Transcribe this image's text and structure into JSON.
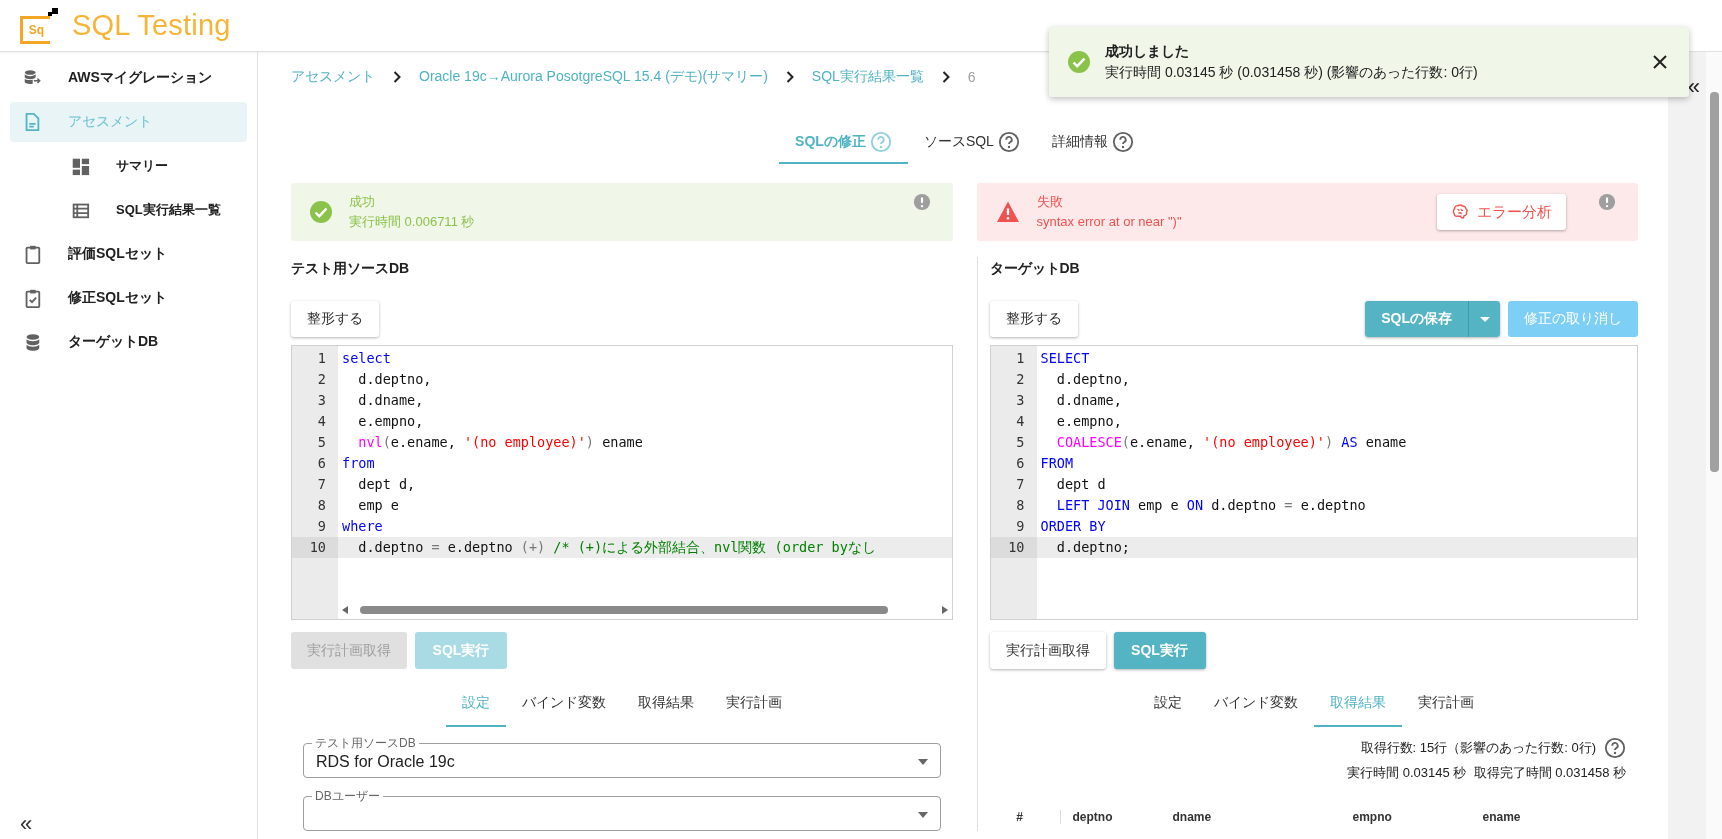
{
  "app": {
    "title": "SQL Testing",
    "logo_text": "Sq"
  },
  "sidebar": {
    "items": [
      {
        "label": "AWSマイグレーション",
        "selected": false
      },
      {
        "label": "アセスメント",
        "selected": true,
        "children": [
          {
            "label": "サマリー",
            "selected": false
          },
          {
            "label": "SQL実行結果一覧",
            "selected": false
          }
        ]
      },
      {
        "label": "評価SQLセット",
        "selected": false
      },
      {
        "label": "修正SQLセット",
        "selected": false
      },
      {
        "label": "ターゲットDB",
        "selected": false
      }
    ],
    "collapse_label": "«"
  },
  "breadcrumb": [
    {
      "label": "アセスメント",
      "link": true
    },
    {
      "label": "Oracle 19c→Aurora PosotgreSQL 15.4 (デモ)(サマリー)",
      "link": true
    },
    {
      "label": "SQL実行結果一覧",
      "link": true
    },
    {
      "label": "6",
      "link": false
    }
  ],
  "tabs": [
    {
      "label": "SQLの修正",
      "selected": true
    },
    {
      "label": "ソースSQL",
      "selected": false
    },
    {
      "label": "詳細情報",
      "selected": false
    }
  ],
  "source_panel": {
    "status": {
      "kind": "success",
      "title": "成功",
      "message": "実行時間 0.006711 秒"
    },
    "heading": "テスト用ソースDB",
    "format_button": "整形する",
    "code": [
      {
        "number": "1",
        "active": false,
        "tokens": [
          {
            "kind": "kw",
            "text": "select"
          }
        ]
      },
      {
        "number": "2",
        "active": false,
        "tokens": [
          {
            "kind": "plain",
            "text": "  d.deptno,"
          }
        ]
      },
      {
        "number": "3",
        "active": false,
        "tokens": [
          {
            "kind": "plain",
            "text": "  d.dname,"
          }
        ]
      },
      {
        "number": "4",
        "active": false,
        "tokens": [
          {
            "kind": "plain",
            "text": "  e.empno,"
          }
        ]
      },
      {
        "number": "5",
        "active": false,
        "tokens": [
          {
            "kind": "fn",
            "text": "  nvl"
          },
          {
            "kind": "punct",
            "text": "("
          },
          {
            "kind": "plain",
            "text": "e.ename, "
          },
          {
            "kind": "str",
            "text": "'(no employee)'"
          },
          {
            "kind": "punct",
            "text": ")"
          },
          {
            "kind": "plain",
            "text": " ename"
          }
        ]
      },
      {
        "number": "6",
        "active": false,
        "tokens": [
          {
            "kind": "kw",
            "text": "from"
          }
        ]
      },
      {
        "number": "7",
        "active": false,
        "tokens": [
          {
            "kind": "plain",
            "text": "  dept d,"
          }
        ]
      },
      {
        "number": "8",
        "active": false,
        "tokens": [
          {
            "kind": "plain",
            "text": "  emp e"
          }
        ]
      },
      {
        "number": "9",
        "active": false,
        "tokens": [
          {
            "kind": "kw",
            "text": "where"
          }
        ]
      },
      {
        "number": "10",
        "active": true,
        "tokens": [
          {
            "kind": "plain",
            "text": "  d.deptno "
          },
          {
            "kind": "punct",
            "text": "="
          },
          {
            "kind": "plain",
            "text": " e.deptno "
          },
          {
            "kind": "punct",
            "text": "(+) "
          },
          {
            "kind": "cmt",
            "text": "/* (+)による外部結合、nvl関数 (order byなし"
          }
        ]
      }
    ],
    "actions": [
      {
        "label": "実行計画取得",
        "kind": "outline",
        "disabled": true
      },
      {
        "label": "SQL実行",
        "kind": "primary",
        "disabled": true
      }
    ],
    "subtabs": [
      {
        "label": "設定",
        "selected": true
      },
      {
        "label": "バインド変数",
        "selected": false
      },
      {
        "label": "取得結果",
        "selected": false
      },
      {
        "label": "実行計画",
        "selected": false
      }
    ],
    "fields": [
      {
        "label": "テスト用ソースDB",
        "value": "RDS for Oracle 19c"
      },
      {
        "label": "DBユーザー"
      }
    ]
  },
  "target_panel": {
    "status": {
      "kind": "error",
      "title": "失敗",
      "message": "syntax error at or near \")\"",
      "action": "エラー分析"
    },
    "heading": "ターゲットDB",
    "format_button": "整形する",
    "save_button": "SQLの保存",
    "undo_button": {
      "label": "修正の取り消し",
      "disabled": true
    },
    "code": [
      {
        "number": "1",
        "active": false,
        "tokens": [
          {
            "kind": "kw",
            "text": "SELECT"
          }
        ]
      },
      {
        "number": "2",
        "active": false,
        "tokens": [
          {
            "kind": "plain",
            "text": "  d.deptno,"
          }
        ]
      },
      {
        "number": "3",
        "active": false,
        "tokens": [
          {
            "kind": "plain",
            "text": "  d.dname,"
          }
        ]
      },
      {
        "number": "4",
        "active": false,
        "tokens": [
          {
            "kind": "plain",
            "text": "  e.empno,"
          }
        ]
      },
      {
        "number": "5",
        "active": false,
        "tokens": [
          {
            "kind": "fn",
            "text": "  COALESCE"
          },
          {
            "kind": "punct",
            "text": "("
          },
          {
            "kind": "plain",
            "text": "e.ename, "
          },
          {
            "kind": "str",
            "text": "'(no employee)'"
          },
          {
            "kind": "punct",
            "text": ") "
          },
          {
            "kind": "kw",
            "text": "AS"
          },
          {
            "kind": "plain",
            "text": " ename"
          }
        ]
      },
      {
        "number": "6",
        "active": false,
        "tokens": [
          {
            "kind": "kw",
            "text": "FROM"
          }
        ]
      },
      {
        "number": "7",
        "active": false,
        "tokens": [
          {
            "kind": "plain",
            "text": "  dept d"
          }
        ]
      },
      {
        "number": "8",
        "active": false,
        "tokens": [
          {
            "kind": "kw",
            "text": "  LEFT JOIN"
          },
          {
            "kind": "plain",
            "text": " emp e "
          },
          {
            "kind": "kw",
            "text": "ON"
          },
          {
            "kind": "plain",
            "text": " d.deptno "
          },
          {
            "kind": "punct",
            "text": "="
          },
          {
            "kind": "plain",
            "text": " e.deptno"
          }
        ]
      },
      {
        "number": "9",
        "active": false,
        "tokens": [
          {
            "kind": "kw",
            "text": "ORDER BY"
          }
        ]
      },
      {
        "number": "10",
        "active": true,
        "tokens": [
          {
            "kind": "plain",
            "text": "  d.deptno;"
          }
        ]
      }
    ],
    "actions": [
      {
        "label": "実行計画取得",
        "kind": "outline",
        "disabled": false
      },
      {
        "label": "SQL実行",
        "kind": "primary",
        "disabled": false
      }
    ],
    "subtabs": [
      {
        "label": "設定",
        "selected": false
      },
      {
        "label": "バインド変数",
        "selected": false
      },
      {
        "label": "取得結果",
        "selected": true
      },
      {
        "label": "実行計画",
        "selected": false
      }
    ],
    "result": {
      "summary": "取得行数: 15行（影響のあった行数: 0行)",
      "timing": "実行時間 0.03145 秒  取得完了時間 0.031458 秒",
      "columns": [
        "#",
        "deptno",
        "dname",
        "empno",
        "ename"
      ]
    }
  },
  "toast": {
    "kind": "success",
    "title": "成功しました",
    "message": "実行時間 0.03145 秒 (0.031458 秒) (影響のあった行数: 0行)"
  },
  "right_rail": {
    "collapse_label": "«"
  }
}
